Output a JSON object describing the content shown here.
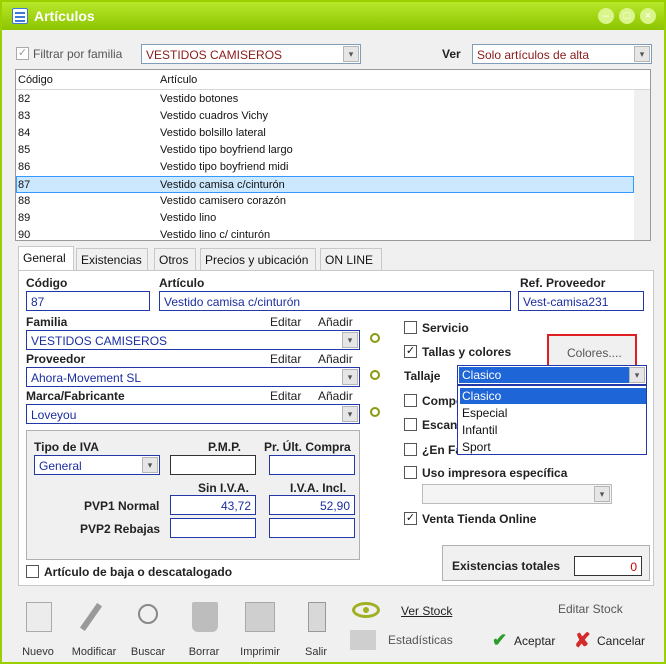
{
  "window": {
    "title": "Artículos"
  },
  "filter": {
    "checkbox_label": "Filtrar por familia",
    "family_value": "VESTIDOS CAMISEROS",
    "ver_label": "Ver",
    "ver_value": "Solo artículos de alta"
  },
  "list": {
    "columns": [
      "Código",
      "Artículo"
    ],
    "rows": [
      {
        "code": "82",
        "name": "Vestido botones"
      },
      {
        "code": "83",
        "name": "Vestido cuadros Vichy"
      },
      {
        "code": "84",
        "name": "Vestido bolsillo lateral"
      },
      {
        "code": "85",
        "name": "Vestido tipo boyfriend largo"
      },
      {
        "code": "86",
        "name": "Vestido tipo boyfriend midi"
      },
      {
        "code": "87",
        "name": "Vestido camisa c/cinturón"
      },
      {
        "code": "88",
        "name": "Vestido camisero corazón"
      },
      {
        "code": "89",
        "name": "Vestido lino"
      },
      {
        "code": "90",
        "name": "Vestido lino c/ cinturón"
      }
    ]
  },
  "tabs": [
    "General",
    "Existencias",
    "Otros",
    "Precios y ubicación",
    "ON LINE"
  ],
  "form": {
    "codigo_label": "Código",
    "codigo_value": "87",
    "articulo_label": "Artículo",
    "articulo_value": "Vestido camisa c/cinturón",
    "ref_label": "Ref. Proveedor",
    "ref_value": "Vest-camisa231",
    "familia_label": "Familia",
    "familia_value": "VESTIDOS CAMISEROS",
    "proveedor_label": "Proveedor",
    "proveedor_value": "Ahora-Movement SL",
    "marca_label": "Marca/Fabricante",
    "marca_value": "Loveyou",
    "editar": "Editar",
    "anadir": "Añadir",
    "iva_label": "Tipo de IVA",
    "iva_value": "General",
    "pmp_label": "P.M.P.",
    "pr_compra_label": "Pr. Últ. Compra",
    "sin_iva_label": "Sin I.V.A.",
    "iva_incl_label": "I.V.A. Incl.",
    "pvp1_label": "PVP1 Normal",
    "pvp1_sin": "43,72",
    "pvp1_con": "52,90",
    "pvp2_label": "PVP2 Rebajas",
    "baja_label": "Artículo de baja o descatalogado",
    "servicio_label": "Servicio",
    "tallas_label": "Tallas y colores",
    "colores_button": "Colores....",
    "tallaje_label": "Tallaje",
    "tallaje_value": "Clasico",
    "tallaje_options": [
      "Clasico",
      "Especial",
      "Infantil",
      "Sport"
    ],
    "compuesto_label": "Compo",
    "escandallo_label": "Escan",
    "en_fabrica_label": "¿En Fa",
    "impresora_label": "Uso impresora específica",
    "venta_online_label": "Venta Tienda Online",
    "existencias_label": "Existencias totales",
    "existencias_value": "0"
  },
  "toolbar": {
    "nuevo": "Nuevo",
    "modificar": "Modificar",
    "buscar": "Buscar",
    "borrar": "Borrar",
    "imprimir": "Imprimir",
    "salir": "Salir",
    "ver_stock": "Ver Stock",
    "estadisticas": "Estadísticas",
    "editar_stock": "Editar Stock",
    "aceptar": "Aceptar",
    "cancelar": "Cancelar"
  },
  "colors": {
    "titlebar": "#9bd000",
    "accent_green": "#8a9a10",
    "selection": "#1e66d8"
  }
}
